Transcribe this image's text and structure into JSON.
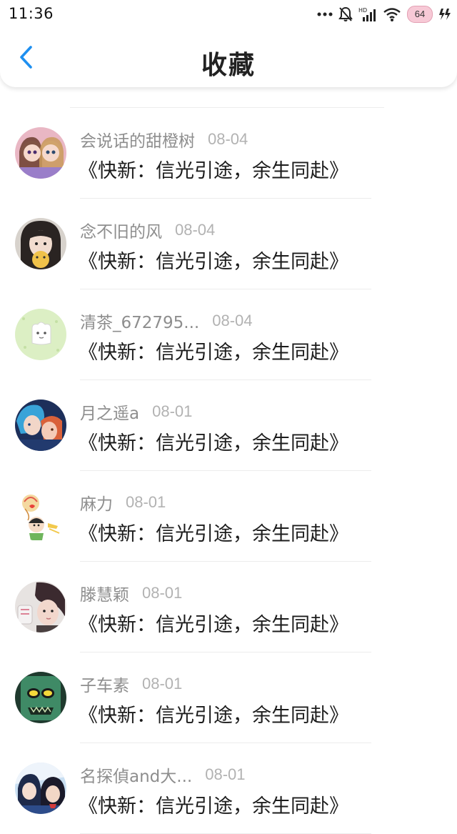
{
  "status_bar": {
    "time": "11:36",
    "battery": "64"
  },
  "header": {
    "title": "收藏"
  },
  "icons": {
    "back": "chevron-left-icon",
    "signal_dots": "more-dots-icon",
    "silent": "bell-off-icon",
    "cell": "signal-bars-icon",
    "wifi": "wifi-icon",
    "charging": "charging-bolt-icon"
  },
  "colors": {
    "accent": "#1e8ff0",
    "title_text": "#222222",
    "username_text": "#8e8e8e",
    "date_text": "#b2b2b2",
    "book_text": "#1c1c1c"
  },
  "favorites": [
    {
      "user": "会说话的甜橙树",
      "date": "08-04",
      "book": "《快新：信光引途，余生同赴》"
    },
    {
      "user": "念不旧的风",
      "date": "08-04",
      "book": "《快新：信光引途，余生同赴》"
    },
    {
      "user": "清茶_672795...",
      "date": "08-04",
      "book": "《快新：信光引途，余生同赴》"
    },
    {
      "user": "月之遥a",
      "date": "08-01",
      "book": "《快新：信光引途，余生同赴》"
    },
    {
      "user": "麻力",
      "date": "08-01",
      "book": "《快新：信光引途，余生同赴》"
    },
    {
      "user": "滕慧颖",
      "date": "08-01",
      "book": "《快新：信光引途，余生同赴》"
    },
    {
      "user": "子车素",
      "date": "08-01",
      "book": "《快新：信光引途，余生同赴》"
    },
    {
      "user": "名探偵and大...",
      "date": "08-01",
      "book": "《快新：信光引途，余生同赴》"
    }
  ]
}
